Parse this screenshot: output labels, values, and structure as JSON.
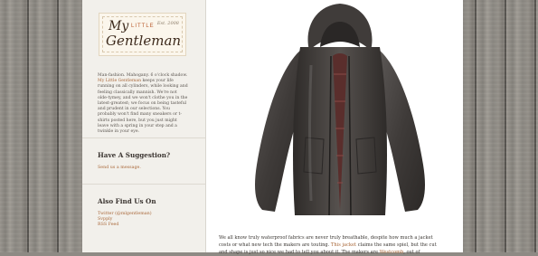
{
  "sidebar": {
    "logo": {
      "my": "My",
      "little": "LITTLE",
      "est": "Est. 2008",
      "gentleman": "Gentleman"
    },
    "intro_before": "Man-fashion. Mahogany. 6 o'clock shadow. ",
    "intro_link": "My Little Gentleman",
    "intro_after": " keeps your life running on all cylinders, while looking and feeling classically mannish. We're not olde-tymey, and we won't clothe you in the latest-greatest; we focus on being tasteful and prudent in our selections. You probably won't find many sneakers or t-shirts posted here, but you just might leave with a spring in your step and a twinkle in your eye.",
    "suggestion": {
      "heading": "Have A Suggestion?",
      "link": "Send us a message."
    },
    "find_us": {
      "heading": "Also Find Us On",
      "links": [
        "Twitter (@mlgentleman)",
        "Svpply",
        "RSS Feed"
      ]
    }
  },
  "main": {
    "image_alt": "jacket-photo",
    "article_line1": "We all know truly waterproof fabrics are never truly breathable, despite how much a jacket",
    "article_line2_before": "costs or what new tech the makers are touting. ",
    "article_line2_link": "This jacket",
    "article_line2_after": " claims the same spiel, but the cut",
    "article_line3_before": "and shape is just so nice we had to tell you about it.  The makers are ",
    "article_line3_link": "Westcomb",
    "article_line3_after": ", out of"
  },
  "colors": {
    "accent": "#a9683a",
    "sidebar_bg": "#f2f0eb",
    "jacket": "#4a4644"
  }
}
